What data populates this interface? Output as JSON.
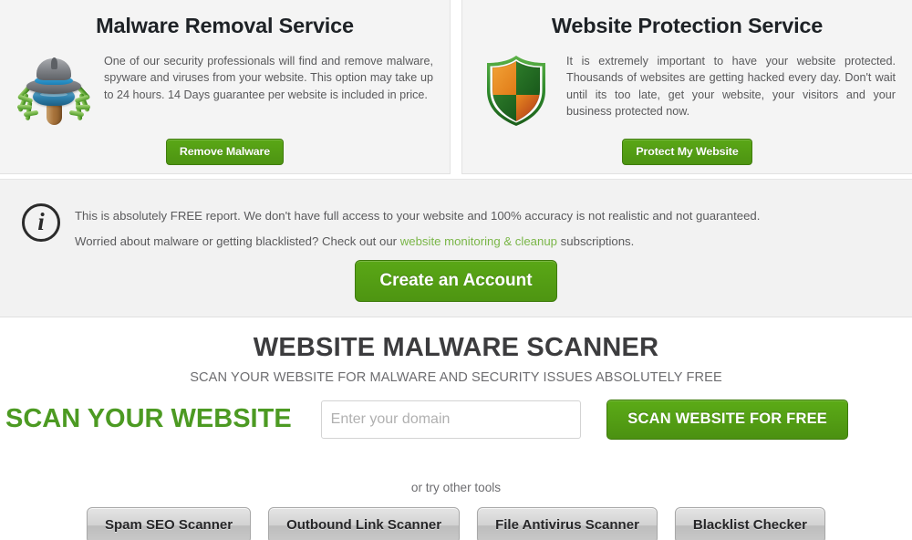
{
  "services": [
    {
      "id": "malware-removal",
      "title": "Malware Removal Service",
      "icon": "spider-hat-icon",
      "description": "One of our security professionals will find and remove malware, spyware and viruses from your website. This option may take up to 24 hours. 14 Days guarantee per website is included in price.",
      "button_label": "Remove Malware"
    },
    {
      "id": "website-protection",
      "title": "Website Protection Service",
      "icon": "shield-icon",
      "description": "It is extremely important to have your website protected. Thousands of websites are getting hacked every day. Don't wait until its too late, get your website, your visitors and your business protected now.",
      "button_label": "Protect My Website"
    }
  ],
  "notice": {
    "icon": "info-circle-icon",
    "icon_glyph": "i",
    "line1": "This is absolutely FREE report. We don't have full access to your website and 100% accuracy is not realistic and not guaranteed.",
    "line2_before": "Worried about malware or getting blacklisted? Check out our ",
    "line2_link": "website monitoring & cleanup",
    "line2_after": " subscriptions.",
    "button_label": "Create an Account"
  },
  "scanner": {
    "title": "WEBSITE MALWARE SCANNER",
    "subtitle": "SCAN YOUR WEBSITE FOR MALWARE AND SECURITY ISSUES ABSOLUTELY FREE",
    "scan_label": "SCAN YOUR WEBSITE",
    "input_placeholder": "Enter your domain",
    "input_value": "",
    "scan_button_label": "SCAN WEBSITE FOR FREE"
  },
  "other_tools": {
    "label": "or try other tools",
    "buttons": [
      {
        "label": "Spam SEO Scanner"
      },
      {
        "label": "Outbound Link Scanner"
      },
      {
        "label": "File Antivirus Scanner"
      },
      {
        "label": "Blacklist Checker"
      }
    ]
  },
  "colors": {
    "brand_green": "#4c9a22",
    "button_green": "#5aa716",
    "link_green": "#7ab648",
    "panel_bg": "#f4f4f4",
    "notice_bg": "#f2f2f2",
    "heading_dark": "#1e2226",
    "body_text": "#59595b"
  }
}
